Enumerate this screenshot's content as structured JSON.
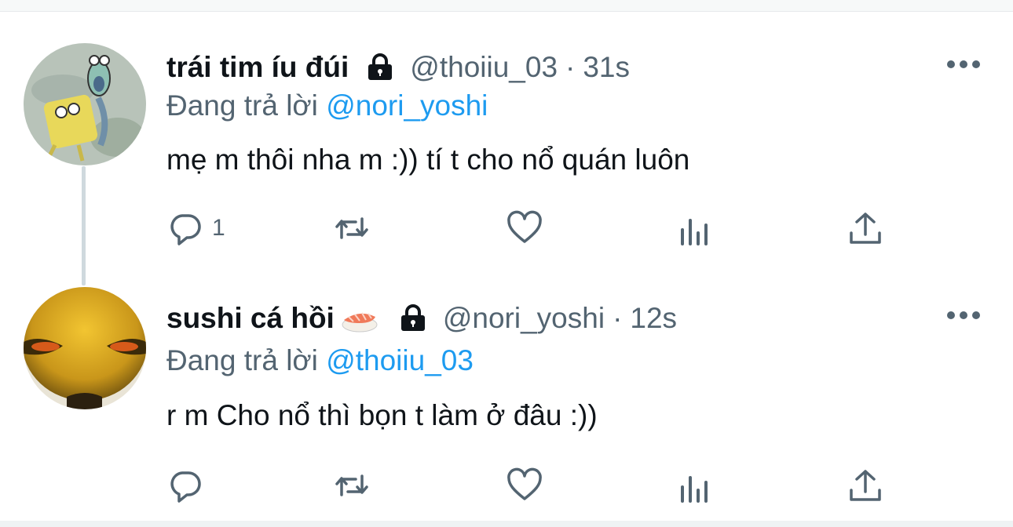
{
  "thread": [
    {
      "author": {
        "display_name": "trái tim íu đúi",
        "handle": "@thoiiu_03",
        "protected": true
      },
      "time": "31s",
      "dot": "·",
      "reply_prefix": "Đang trả lời",
      "reply_to": "@nori_yoshi",
      "text": "mẹ m thôi nha m :)) tí t cho nổ quán luôn",
      "reply_count": "1",
      "avatar": "spongebob-screaming"
    },
    {
      "author": {
        "display_name": "sushi cá hồi",
        "handle": "@nori_yoshi",
        "protected": true,
        "emoji": "sushi"
      },
      "time": "12s",
      "dot": "·",
      "reply_prefix": "Đang trả lời",
      "reply_to": "@thoiiu_03",
      "text": "r m Cho nổ thì bọn t làm ở đâu :))",
      "reply_count": "",
      "avatar": "yellow-face"
    }
  ],
  "icons": [
    "reply-icon",
    "retweet-icon",
    "like-icon",
    "analytics-icon",
    "share-icon",
    "lock-icon",
    "more-icon"
  ],
  "colors": {
    "mention": "#1d9bf0",
    "secondary": "#536471",
    "text": "#0f1419",
    "thread_line": "#cfd9de"
  }
}
